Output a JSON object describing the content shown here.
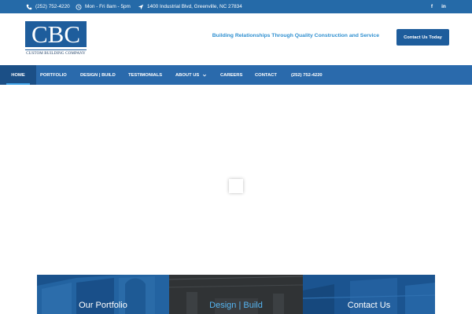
{
  "topbar": {
    "phone": "(252) 752-4220",
    "hours": "Mon - Fri 8am - 5pm",
    "address": "1400 Industrial Blvd, Greenville, NC 27834",
    "social": [
      "f",
      "in"
    ]
  },
  "header": {
    "logo_letters": "CBC",
    "logo_tagline": "CUSTOM BUILDING COMPANY",
    "tagline": "Building Relationships Through Quality Construction and Service",
    "cta_label": "Contact Us Today"
  },
  "nav": {
    "items": [
      "HOME",
      "PORTFOLIO",
      "DESIGN | BUILD",
      "TESTIMONIALS",
      "ABOUT US",
      "CAREERS",
      "CONTACT",
      "(252) 752-4220"
    ],
    "active_index": 0
  },
  "panels": [
    {
      "title": "Our Portfolio",
      "title_color": "#ffffff"
    },
    {
      "title": "Design | Build",
      "title_color": "#55b4f0"
    },
    {
      "title": "Contact Us",
      "title_color": "#ffffff"
    }
  ],
  "colors": {
    "brand_blue": "#1e5d9c",
    "nav_blue": "#2a6aac",
    "accent_light_blue": "#2e8fd0"
  },
  "icons": {
    "phone": "phone-icon",
    "hours": "clock-icon",
    "address": "location-arrow-icon",
    "submenu": "chevron-down-icon"
  }
}
